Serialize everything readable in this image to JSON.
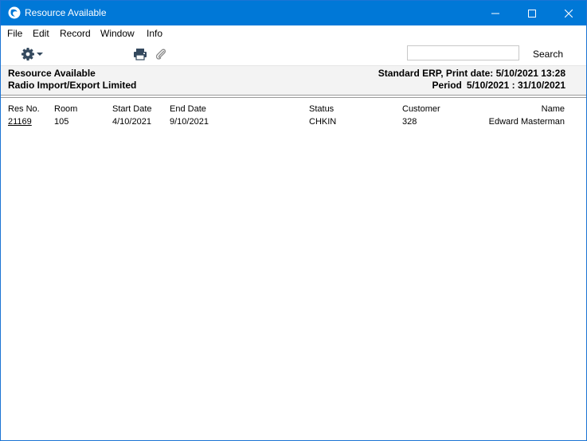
{
  "window": {
    "title": "Resource Available",
    "accent_color": "#0078d7"
  },
  "menu": {
    "items": [
      "File",
      "Edit",
      "Record",
      "Window",
      "Info"
    ]
  },
  "toolbar": {
    "gear_icon": "gear-icon",
    "print_icon": "print-icon",
    "attach_icon": "paperclip-icon",
    "search_value": "",
    "search_label": "Search"
  },
  "report": {
    "title": "Resource Available",
    "company": "Radio Import/Export Limited",
    "print_info": "Standard ERP, Print date: 5/10/2021 13:28",
    "period_label": "Period",
    "period_value": "5/10/2021 : 31/10/2021"
  },
  "table": {
    "columns": [
      "Res No.",
      "Room",
      "Start Date",
      "End Date",
      "Status",
      "Customer",
      "Name"
    ],
    "rows": [
      {
        "res_no": "21169",
        "room": "105",
        "start_date": "4/10/2021",
        "end_date": "9/10/2021",
        "status": "CHKIN",
        "customer": "328",
        "name": "Edward Masterman"
      }
    ]
  }
}
